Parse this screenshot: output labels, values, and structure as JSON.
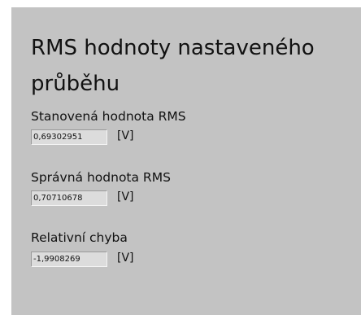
{
  "panel": {
    "title": "RMS hodnoty nastaveného průběhu",
    "indicators": [
      {
        "label": "Stanovená hodnota RMS",
        "value": "0,69302951",
        "unit": "[V]"
      },
      {
        "label": "Správná hodnota RMS",
        "value": "0,70710678",
        "unit": "[V]"
      },
      {
        "label": "Relativní chyba",
        "value": "-1,9908269",
        "unit": "[V]"
      }
    ]
  },
  "colors": {
    "panel_background": "#c3c3c3",
    "indicator_background": "#dcdcdc"
  }
}
